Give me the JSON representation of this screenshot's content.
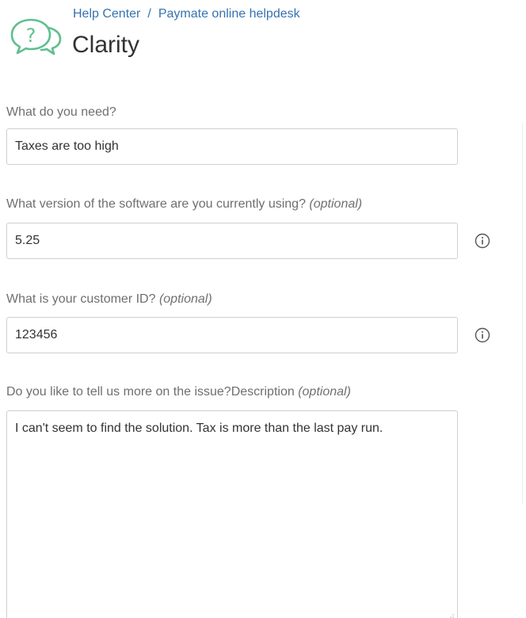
{
  "header": {
    "breadcrumbs": [
      "Help Center",
      "Paymate online helpdesk"
    ],
    "separator": "/",
    "title": "Clarity",
    "icon": "help-chat-bubbles-icon"
  },
  "form": {
    "need": {
      "label": "What do you need?",
      "value": "Taxes are too high"
    },
    "version": {
      "label": "What version of the software are you currently using?",
      "optional": "(optional)",
      "value": "5.25",
      "info_icon": "info-icon"
    },
    "customer_id": {
      "label": "What is your customer ID?",
      "optional": "(optional)",
      "value": "123456",
      "info_icon": "info-icon"
    },
    "description": {
      "label": "Do you like to tell us more on the issue?Description",
      "optional": "(optional)",
      "value": "I can't seem to find the solution. Tax is more than the last pay run."
    }
  },
  "colors": {
    "link": "#3572b0",
    "label": "#6f6f6f",
    "border": "#cfcfcf",
    "text": "#333333",
    "icon": "#5fbf8e"
  }
}
